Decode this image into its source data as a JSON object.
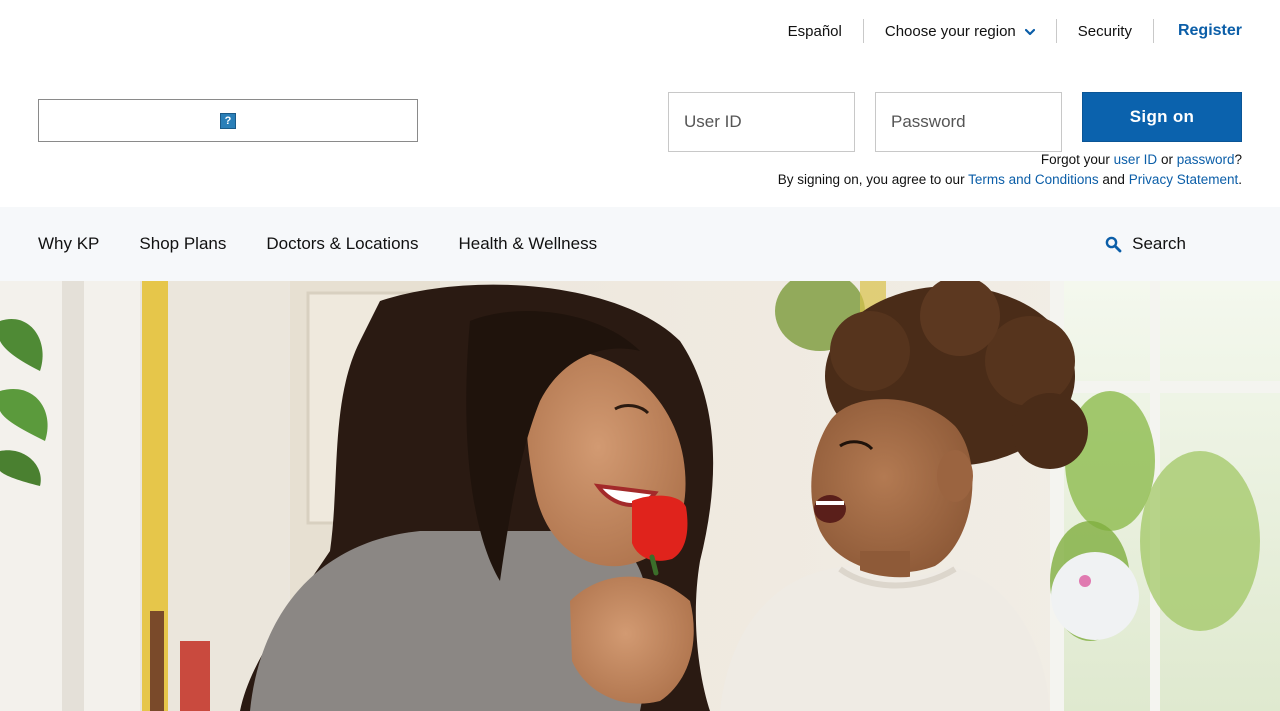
{
  "utility": {
    "espanol": "Español",
    "region": "Choose your region",
    "security": "Security",
    "register": "Register"
  },
  "signon": {
    "userid_placeholder": "User ID",
    "password_placeholder": "Password",
    "button": "Sign on",
    "forgot_prefix": "Forgot your ",
    "forgot_userid": "user ID",
    "forgot_or": " or ",
    "forgot_password": "password",
    "forgot_suffix": "?",
    "agree_prefix": "By signing on, you agree to our ",
    "terms": "Terms and Conditions",
    "agree_and": " and ",
    "privacy": "Privacy Statement",
    "agree_suffix": "."
  },
  "nav": {
    "items": [
      "Why KP",
      "Shop Plans",
      "Doctors & Locations",
      "Health & Wellness"
    ],
    "search": "Search"
  },
  "colors": {
    "brand_blue": "#0b62ad",
    "link_blue": "#0b5ea8",
    "nav_bg": "#f6f8fa"
  },
  "icons": {
    "region_toggle": "chevron-down-icon",
    "logo": "broken-image-icon",
    "search": "search-icon"
  }
}
